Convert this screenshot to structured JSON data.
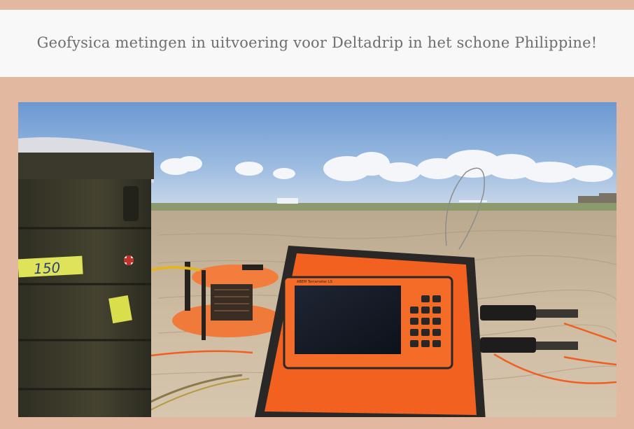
{
  "caption": "Geofysica metingen in uitvoering voor Deltadrip in het schone Philippine!",
  "photo": {
    "case_marking": "150",
    "device_brand": "ABEM",
    "device_model": "Terrameter LS",
    "colors": {
      "background": "#e2b8a0",
      "caption_band": "#f8f8f8",
      "caption_text": "#6e6e6e",
      "device_orange": "#f2611f",
      "case_green": "#3b3a2c",
      "sky": "#7fa6d6",
      "field": "#cdbda6"
    }
  }
}
